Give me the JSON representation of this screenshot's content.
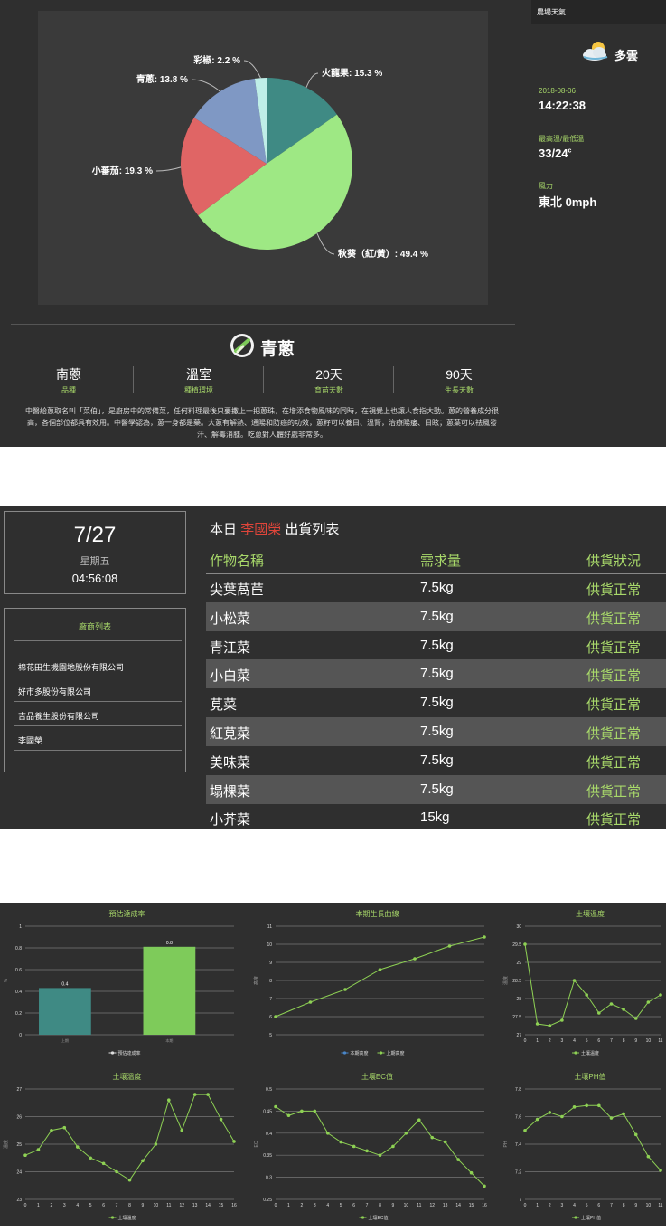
{
  "pie": {
    "slices": [
      {
        "label": "火龍果: 15.3 %",
        "value": 15.3,
        "color": "#3f8a84"
      },
      {
        "label": "秋葵（紅/黃）: 49.4 %",
        "value": 49.4,
        "color": "#9ee884"
      },
      {
        "label": "小蕃茄: 19.3 %",
        "value": 19.3,
        "color": "#e06565"
      },
      {
        "label": "青蔥: 13.8 %",
        "value": 13.8,
        "color": "#7f98c4"
      },
      {
        "label": "彩椒: 2.2 %",
        "value": 2.2,
        "color": "#bfeee8"
      }
    ]
  },
  "weather": {
    "title": "農場天氣",
    "condition": "多雲",
    "date": "2018-08-06",
    "time": "14:22:38",
    "temp_label": "最高溫/最低溫",
    "temp": "33/24",
    "temp_unit": "c",
    "wind_label": "風力",
    "wind": "東北 0mph",
    "icon": "cloudy-sun-icon"
  },
  "crop": {
    "name": "青蔥",
    "icon": "green-onion-icon",
    "stats": [
      {
        "value": "南蔥",
        "label": "品種"
      },
      {
        "value": "溫室",
        "label": "種植環境"
      },
      {
        "value": "20天",
        "label": "育苗天數"
      },
      {
        "value": "90天",
        "label": "生長天數"
      }
    ],
    "description": "中醫給蔥取名叫「菜伯」，是廚房中的常備菜，任何料理最後只要撒上一把蔥珠，在增添食物風味的同時，在視覺上也讓人食指大動。蔥的營養成分很高，各個部位都具有效用。中醫學認為，蔥一身都是藥。大蔥有解熱、通陽和防癌的功效，蔥籽可以養目、溫腎，治療陽痿、目眩；蔥葉可以祛風發汗、解毒消腫。吃蔥對人體好處非常多。"
  },
  "date_card": {
    "date": "7/27",
    "weekday": "星期五",
    "time": "04:56:08"
  },
  "vendors": {
    "title": "廠商列表",
    "items": [
      "棉花田生機園地股份有限公司",
      "好市多股份有限公司",
      "吉品養生股份有限公司",
      "李國榮"
    ]
  },
  "shipping": {
    "title_prefix": "本日",
    "title_name": "李國榮",
    "title_suffix": "出貨列表",
    "headers": [
      "作物名稱",
      "需求量",
      "供貨狀況"
    ],
    "rows": [
      [
        "尖葉萵苣",
        "7.5kg",
        "供貨正常"
      ],
      [
        "小松菜",
        "7.5kg",
        "供貨正常"
      ],
      [
        "青江菜",
        "7.5kg",
        "供貨正常"
      ],
      [
        "小白菜",
        "7.5kg",
        "供貨正常"
      ],
      [
        "莧菜",
        "7.5kg",
        "供貨正常"
      ],
      [
        "紅莧菜",
        "7.5kg",
        "供貨正常"
      ],
      [
        "美味菜",
        "7.5kg",
        "供貨正常"
      ],
      [
        "塌棵菜",
        "7.5kg",
        "供貨正常"
      ],
      [
        "小芥菜",
        "15kg",
        "供貨正常"
      ]
    ]
  },
  "chart_data": [
    {
      "type": "bar",
      "title": "預估達成率",
      "categories": [
        "上期",
        "本期"
      ],
      "values": [
        0.43,
        0.81
      ],
      "data_labels": [
        "0.4",
        "0.8"
      ],
      "colors": [
        "#3f8a84",
        "#7ecb5a"
      ],
      "ylabel": "%",
      "ylim": [
        0,
        1
      ],
      "yticks": [
        "0",
        "0.2",
        "0.4",
        "0.6",
        "0.8",
        "1"
      ],
      "legend": [
        "預估達成率"
      ]
    },
    {
      "type": "line",
      "title": "本期生長曲線",
      "ylabel": "高度",
      "x": [
        0,
        1,
        2,
        3,
        4,
        5,
        6
      ],
      "series": [
        {
          "name": "上期高度",
          "values": [
            6.0,
            6.8,
            7.5,
            8.6,
            9.2,
            9.9,
            10.4
          ]
        }
      ],
      "ylim": [
        5,
        11
      ],
      "yticks": [
        "5",
        "6",
        "7",
        "8",
        "9",
        "10",
        "11"
      ],
      "legend": [
        "本期高度",
        "上期高度"
      ]
    },
    {
      "type": "line",
      "title": "土壤溫度",
      "ylabel": "溫度",
      "x": [
        0,
        1,
        2,
        3,
        4,
        5,
        6,
        7,
        8,
        9,
        10,
        11
      ],
      "series": [
        {
          "name": "土壤溫度",
          "values": [
            29.5,
            27.3,
            27.25,
            27.4,
            28.5,
            28.1,
            27.6,
            27.85,
            27.7,
            27.45,
            27.9,
            28.1
          ]
        }
      ],
      "ylim": [
        27,
        30
      ],
      "yticks": [
        "27",
        "27.5",
        "28",
        "28.5",
        "29",
        "29.5",
        "30"
      ],
      "legend": [
        "土壤溫度"
      ]
    },
    {
      "type": "line",
      "title": "土壤溫度",
      "ylabel": "溫度",
      "x": [
        0,
        1,
        2,
        3,
        4,
        5,
        6,
        7,
        8,
        9,
        10,
        11,
        12,
        13,
        14,
        15,
        16
      ],
      "series": [
        {
          "name": "土壤溫度",
          "values": [
            24.6,
            24.8,
            25.5,
            25.6,
            24.9,
            24.5,
            24.3,
            24.0,
            23.7,
            24.4,
            25.0,
            26.6,
            25.5,
            26.8,
            26.8,
            25.9,
            25.1
          ]
        }
      ],
      "ylim": [
        23,
        27
      ],
      "yticks": [
        "23",
        "24",
        "25",
        "26",
        "27"
      ],
      "legend": [
        "土壤溫度"
      ]
    },
    {
      "type": "line",
      "title": "土壤EC值",
      "ylabel": "EC",
      "x": [
        0,
        1,
        2,
        3,
        4,
        5,
        6,
        7,
        8,
        9,
        10,
        11,
        12,
        13,
        14,
        15,
        16
      ],
      "series": [
        {
          "name": "土壤EC值",
          "values": [
            0.46,
            0.44,
            0.45,
            0.45,
            0.4,
            0.38,
            0.37,
            0.36,
            0.35,
            0.37,
            0.4,
            0.43,
            0.39,
            0.38,
            0.34,
            0.31,
            0.28
          ]
        }
      ],
      "ylim": [
        0.25,
        0.5
      ],
      "yticks": [
        "0.25",
        "0.3",
        "0.35",
        "0.4",
        "0.45",
        "0.5"
      ],
      "legend": [
        "土壤EC值"
      ]
    },
    {
      "type": "line",
      "title": "土壤PH值",
      "ylabel": "PH",
      "x": [
        0,
        1,
        2,
        3,
        4,
        5,
        6,
        7,
        8,
        9,
        10,
        11
      ],
      "series": [
        {
          "name": "土壤PH值",
          "values": [
            7.5,
            7.58,
            7.63,
            7.6,
            7.67,
            7.68,
            7.68,
            7.59,
            7.62,
            7.47,
            7.31,
            7.21
          ]
        }
      ],
      "ylim": [
        7,
        7.8
      ],
      "yticks": [
        "7",
        "7.2",
        "7.4",
        "7.6",
        "7.8"
      ],
      "legend": [
        "土壤PH值"
      ]
    }
  ]
}
